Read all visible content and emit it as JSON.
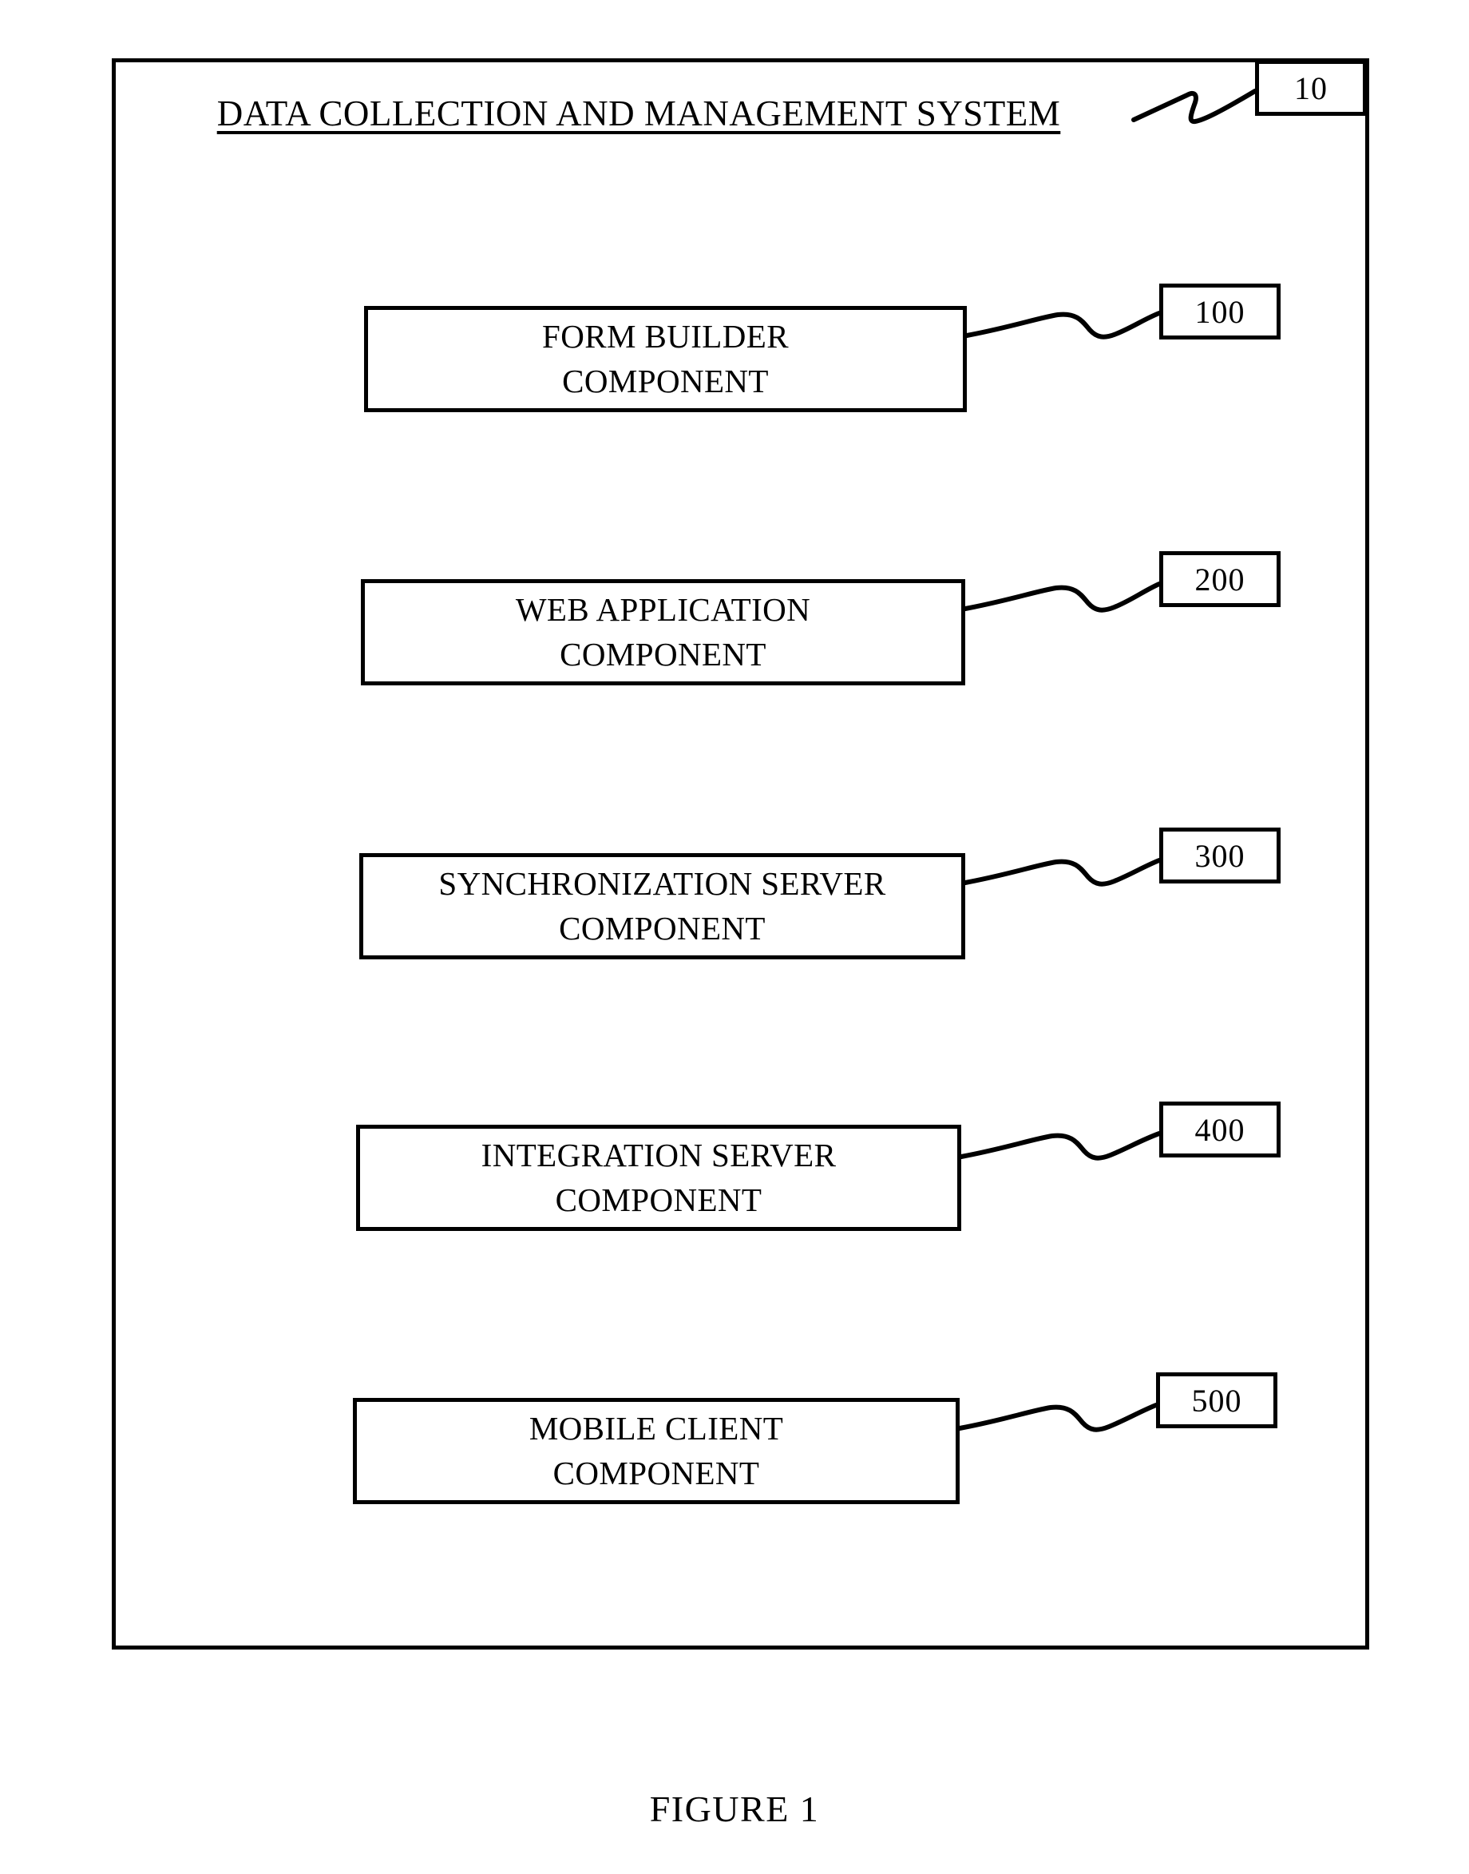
{
  "figure": {
    "title": "DATA COLLECTION AND MANAGEMENT SYSTEM",
    "system_reference": "10",
    "caption": "FIGURE 1",
    "line_color": "#000000",
    "background_color": "#ffffff"
  },
  "components": [
    {
      "line1": "FORM BUILDER",
      "line2": "COMPONENT",
      "reference": "100"
    },
    {
      "line1": "WEB APPLICATION",
      "line2": "COMPONENT",
      "reference": "200"
    },
    {
      "line1": "SYNCHRONIZATION SERVER",
      "line2": "COMPONENT",
      "reference": "300"
    },
    {
      "line1": "INTEGRATION SERVER",
      "line2": "COMPONENT",
      "reference": "400"
    },
    {
      "line1": "MOBILE CLIENT",
      "line2": "COMPONENT",
      "reference": "500"
    }
  ]
}
